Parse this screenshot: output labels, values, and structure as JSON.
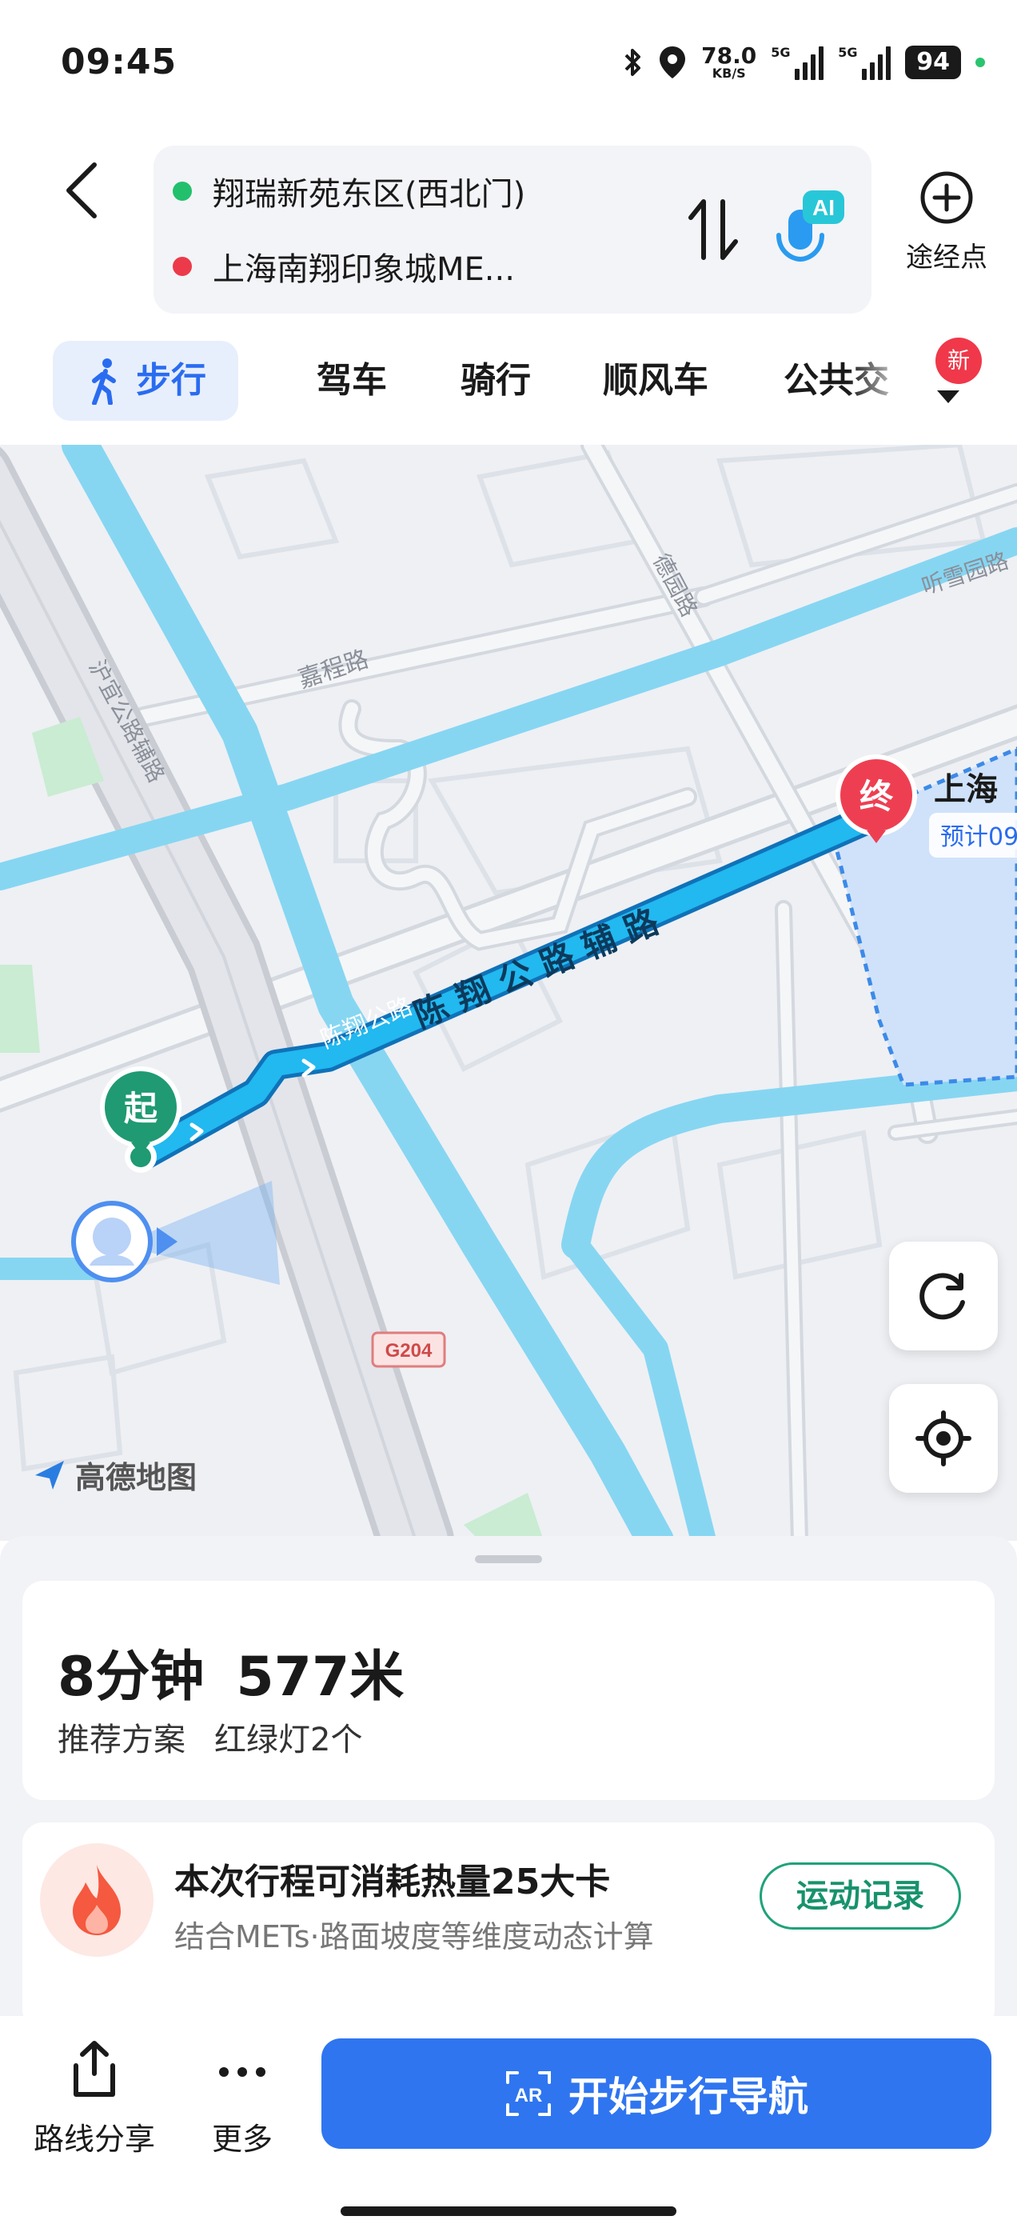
{
  "status_bar": {
    "time": "09:45",
    "net_speed_value": "78.0",
    "net_speed_unit": "KB/S",
    "signal1_label": "5G",
    "signal2_label": "5G",
    "battery": "94"
  },
  "route": {
    "origin": "翔瑞新苑东区(西北门)",
    "destination": "上海南翔印象城ME...",
    "ai_label": "AI",
    "waypoint_label": "途经点"
  },
  "tabs": [
    {
      "label": "步行",
      "active": true
    },
    {
      "label": "驾车"
    },
    {
      "label": "骑行"
    },
    {
      "label": "顺风车"
    },
    {
      "label": "公共交"
    }
  ],
  "new_badge": "新",
  "map": {
    "road_labels": {
      "main_route": "陈 翔 公 路 辅 路",
      "route_small": "陈翔公路",
      "jiacheng": "嘉程路",
      "huyi": "沪宜公路辅路",
      "deyuan": "德园路",
      "tingxue": "听雪园路",
      "g204": "G204"
    },
    "start_marker": "起",
    "end_marker": "终",
    "end_callout_title": "上海",
    "end_callout_sub": "预计09",
    "logo_text": "高德地图"
  },
  "summary": {
    "duration": "8分钟",
    "distance": "577米",
    "tag": "推荐方案",
    "traffic_lights": "红绿灯2个"
  },
  "calories": {
    "title": "本次行程可消耗热量25大卡",
    "subtitle": "结合METs·路面坡度等维度动态计算",
    "button": "运动记录"
  },
  "actions": {
    "share": "路线分享",
    "more": "更多",
    "start": "开始步行导航",
    "ar_label": "AR"
  },
  "colors": {
    "route_blue": "#1fb3ec",
    "accent_blue": "#2f75f0",
    "start_green": "#1f9a72",
    "end_red": "#ee3f52"
  }
}
